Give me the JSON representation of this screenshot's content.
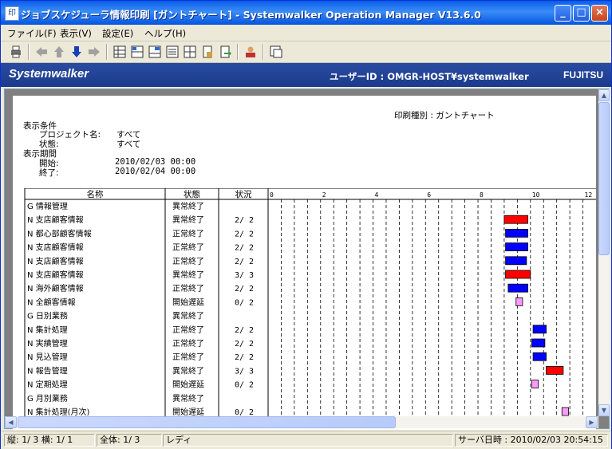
{
  "window": {
    "title": "ジョブスケジューラ情報印刷 [ガントチャート] - Systemwalker Operation Manager  V13.6.0"
  },
  "menu": [
    "ファイル(F)",
    "表示(V)",
    "設定(E)",
    "ヘルプ(H)"
  ],
  "banner": {
    "logo": "Systemwalker",
    "user_label": "ユーザーID : OMGR-HOST¥systemwalker",
    "vendor": "FUJITSU"
  },
  "report": {
    "print_type": "印刷種別 : ガントチャート",
    "conditions_heading": "表示条件",
    "project_label": "プロジェクト名:",
    "project_value": "すべて",
    "state_label": "状態:",
    "state_value": "すべて",
    "period_heading": "表示期間",
    "start_label": "開始:",
    "start_value": "2010/02/03 00:00",
    "end_label": "終了:",
    "end_value": "2010/02/04 00:00"
  },
  "table": {
    "headers": {
      "name": "名称",
      "state": "状態",
      "status": "状況"
    },
    "rows": [
      {
        "name": "G 情報管理",
        "state": "異常終了",
        "status": ""
      },
      {
        "name": "N 支店顧客情報",
        "state": "異常終了",
        "status": "2/  2"
      },
      {
        "name": "N 都心部顧客情報",
        "state": "正常終了",
        "status": "2/  2"
      },
      {
        "name": "N 支店顧客情報",
        "state": "正常終了",
        "status": "2/  2"
      },
      {
        "name": "N 支店顧客情報",
        "state": "正常終了",
        "status": "2/  2"
      },
      {
        "name": "N 支店顧客情報",
        "state": "異常終了",
        "status": "3/  3"
      },
      {
        "name": "N 海外顧客情報",
        "state": "正常終了",
        "status": "2/  2"
      },
      {
        "name": "N 全顧客情報",
        "state": "開始遅延",
        "status": "0/  2"
      },
      {
        "name": "G 日別業務",
        "state": "異常終了",
        "status": ""
      },
      {
        "name": "N 集計処理",
        "state": "正常終了",
        "status": "2/  2"
      },
      {
        "name": "N 実績管理",
        "state": "正常終了",
        "status": "2/  2"
      },
      {
        "name": "N 見込管理",
        "state": "正常終了",
        "status": "2/  2"
      },
      {
        "name": "N 報告管理",
        "state": "異常終了",
        "status": "3/  3"
      },
      {
        "name": "N 定期処理",
        "state": "開始遅延",
        "status": "0/  2"
      },
      {
        "name": "G 月別業務",
        "state": "異常終了",
        "status": ""
      },
      {
        "name": "N 集計処理(月次)",
        "state": "開始遅延",
        "status": "0/  2"
      }
    ]
  },
  "chart_data": {
    "type": "gantt",
    "axis_ticks": [
      0,
      2,
      4,
      6,
      8,
      10,
      12
    ],
    "xlim": [
      0,
      12.5
    ],
    "colors": {
      "abnormal": "#ff0000",
      "normal": "#0000ff",
      "delayed": "#ff99ff"
    },
    "bars": [
      {
        "row": 1,
        "start": 9.0,
        "end": 9.9,
        "kind": "abnormal"
      },
      {
        "row": 2,
        "start": 9.05,
        "end": 9.9,
        "kind": "normal"
      },
      {
        "row": 3,
        "start": 9.05,
        "end": 9.9,
        "kind": "normal"
      },
      {
        "row": 4,
        "start": 9.05,
        "end": 9.85,
        "kind": "normal"
      },
      {
        "row": 5,
        "start": 9.05,
        "end": 10.0,
        "kind": "abnormal"
      },
      {
        "row": 6,
        "start": 9.15,
        "end": 9.9,
        "kind": "normal"
      },
      {
        "row": 7,
        "start": 9.45,
        "end": 9.7,
        "kind": "delayed"
      },
      {
        "row": 9,
        "start": 10.1,
        "end": 10.6,
        "kind": "normal"
      },
      {
        "row": 10,
        "start": 10.05,
        "end": 10.55,
        "kind": "normal"
      },
      {
        "row": 11,
        "start": 10.1,
        "end": 10.6,
        "kind": "normal"
      },
      {
        "row": 12,
        "start": 10.6,
        "end": 11.25,
        "kind": "abnormal"
      },
      {
        "row": 13,
        "start": 10.05,
        "end": 10.3,
        "kind": "delayed"
      },
      {
        "row": 15,
        "start": 11.2,
        "end": 11.45,
        "kind": "delayed"
      }
    ]
  },
  "statusbar": {
    "page": "縦: 1/ 3 横: 1/ 1",
    "total": "全体:  1/  3",
    "ready": "レディ",
    "server_time": "サーバ日時 : 2010/02/03 20:54:15"
  }
}
